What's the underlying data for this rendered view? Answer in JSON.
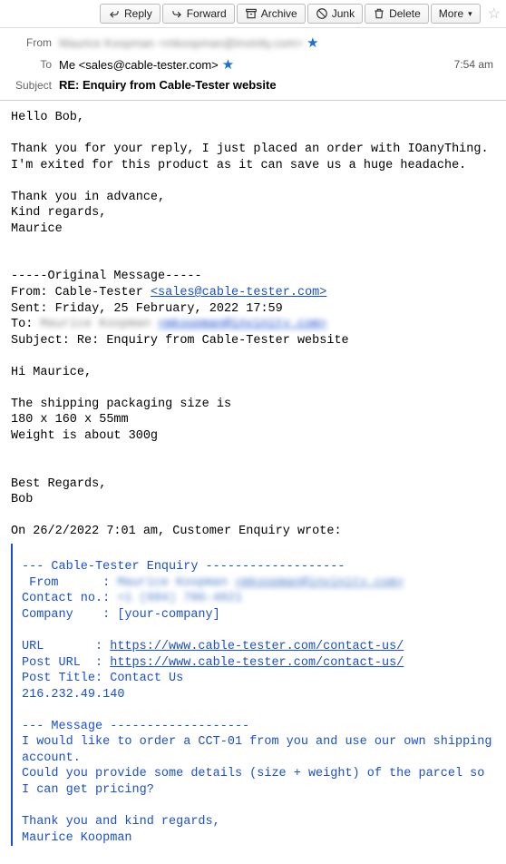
{
  "toolbar": {
    "reply": "Reply",
    "forward": "Forward",
    "archive": "Archive",
    "junk": "Junk",
    "delete": "Delete",
    "more": "More"
  },
  "headers": {
    "from_label": "From",
    "from_name_blur": "Maurice Koopman",
    "from_addr_blur": "<mkoopman@invinity.com>",
    "to_label": "To",
    "to_value": "Me <sales@cable-tester.com>",
    "time": "7:54 am",
    "subject_label": "Subject",
    "subject_value": "RE: Enquiry from Cable-Tester website"
  },
  "body": {
    "greeting": "Hello Bob,",
    "p1": "Thank you for your reply, I just placed an order with IOanyThing.\nI'm exited for this product as it can save us a huge headache.",
    "p2": "Thank you in advance,\nKind regards,\nMaurice",
    "orig_divider": "-----Original Message-----",
    "orig_from_label": "From: Cable-Tester ",
    "orig_from_link": "<sales@cable-tester.com>",
    "orig_sent": "Sent: Friday, 25 February, 2022 17:59",
    "orig_to_label": "To: ",
    "orig_to_name_blur": "Maurice Koopman",
    "orig_to_addr_blur": "<mkoopman@invinity.com>",
    "orig_subject": "Subject: Re: Enquiry from Cable-Tester website",
    "hi": "Hi Maurice,",
    "ship": "The shipping packaging size is\n180 x 160 x 55mm\nWeight is about 300g",
    "best": "Best Regards,\nBob",
    "on_line": "On 26/2/2022 7:01 am, Customer Enquiry wrote:"
  },
  "quoted": {
    "enq_header": "--- Cable-Tester Enquiry -------------------",
    "from_label": " From      : ",
    "from_name_blur": "Maurice Koopman",
    "from_addr_blur": "<mkoopman@invinity.com>",
    "contact_label": "Contact no.: ",
    "contact_blur": "+1 (604) 706-4821",
    "company": "Company    : [your-company]",
    "url_label": "URL       : ",
    "url_link": "https://www.cable-tester.com/contact-us/",
    "posturl_label": "Post URL  : ",
    "posturl_link": "https://www.cable-tester.com/contact-us/",
    "post_title": "Post Title: Contact Us",
    "ip": "216.232.49.140",
    "msg_header": "--- Message -------------------",
    "msg_body": "I would like to order a CCT-01 from you and use our own shipping account.\nCould you provide some details (size + weight) of the parcel so I can get pricing?",
    "signoff": "Thank you and kind regards,\nMaurice Koopman"
  }
}
